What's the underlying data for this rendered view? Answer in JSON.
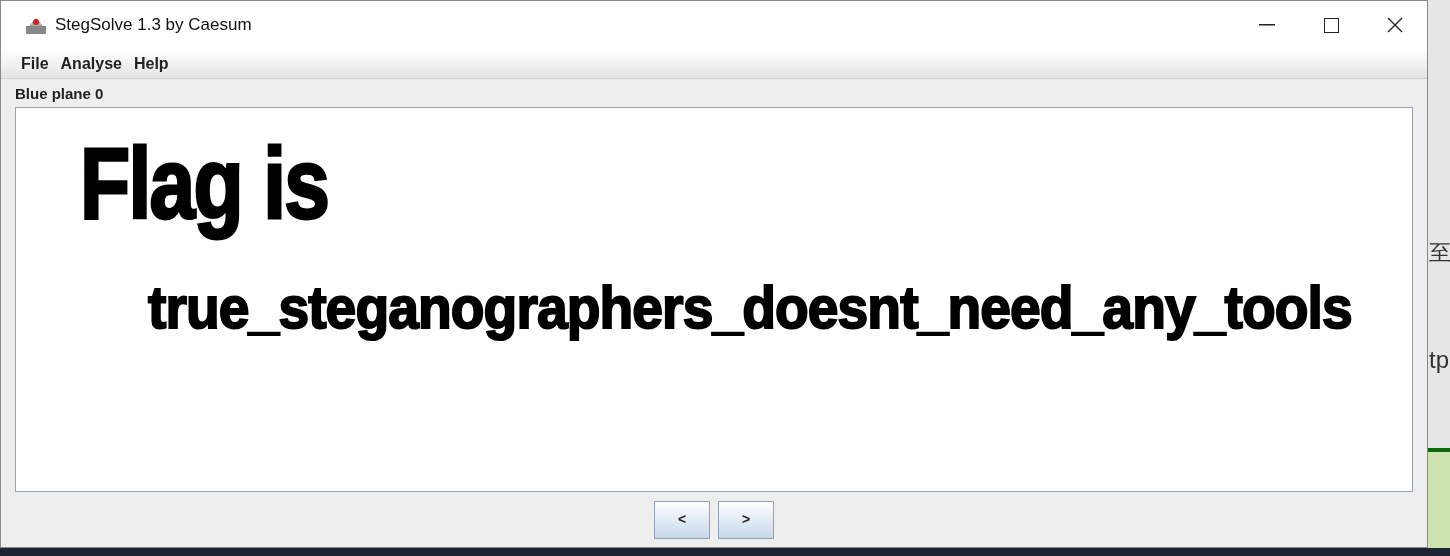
{
  "window": {
    "title": "StegSolve 1.3 by Caesum"
  },
  "menu": [
    "File",
    "Analyse",
    "Help"
  ],
  "plane_label": "Blue plane 0",
  "image_text": [
    "Flag is",
    "true_steganographers_doesnt_need_any_tools"
  ],
  "buttons": [
    "<",
    ">"
  ],
  "background_fragments": [
    "至",
    "tp"
  ]
}
